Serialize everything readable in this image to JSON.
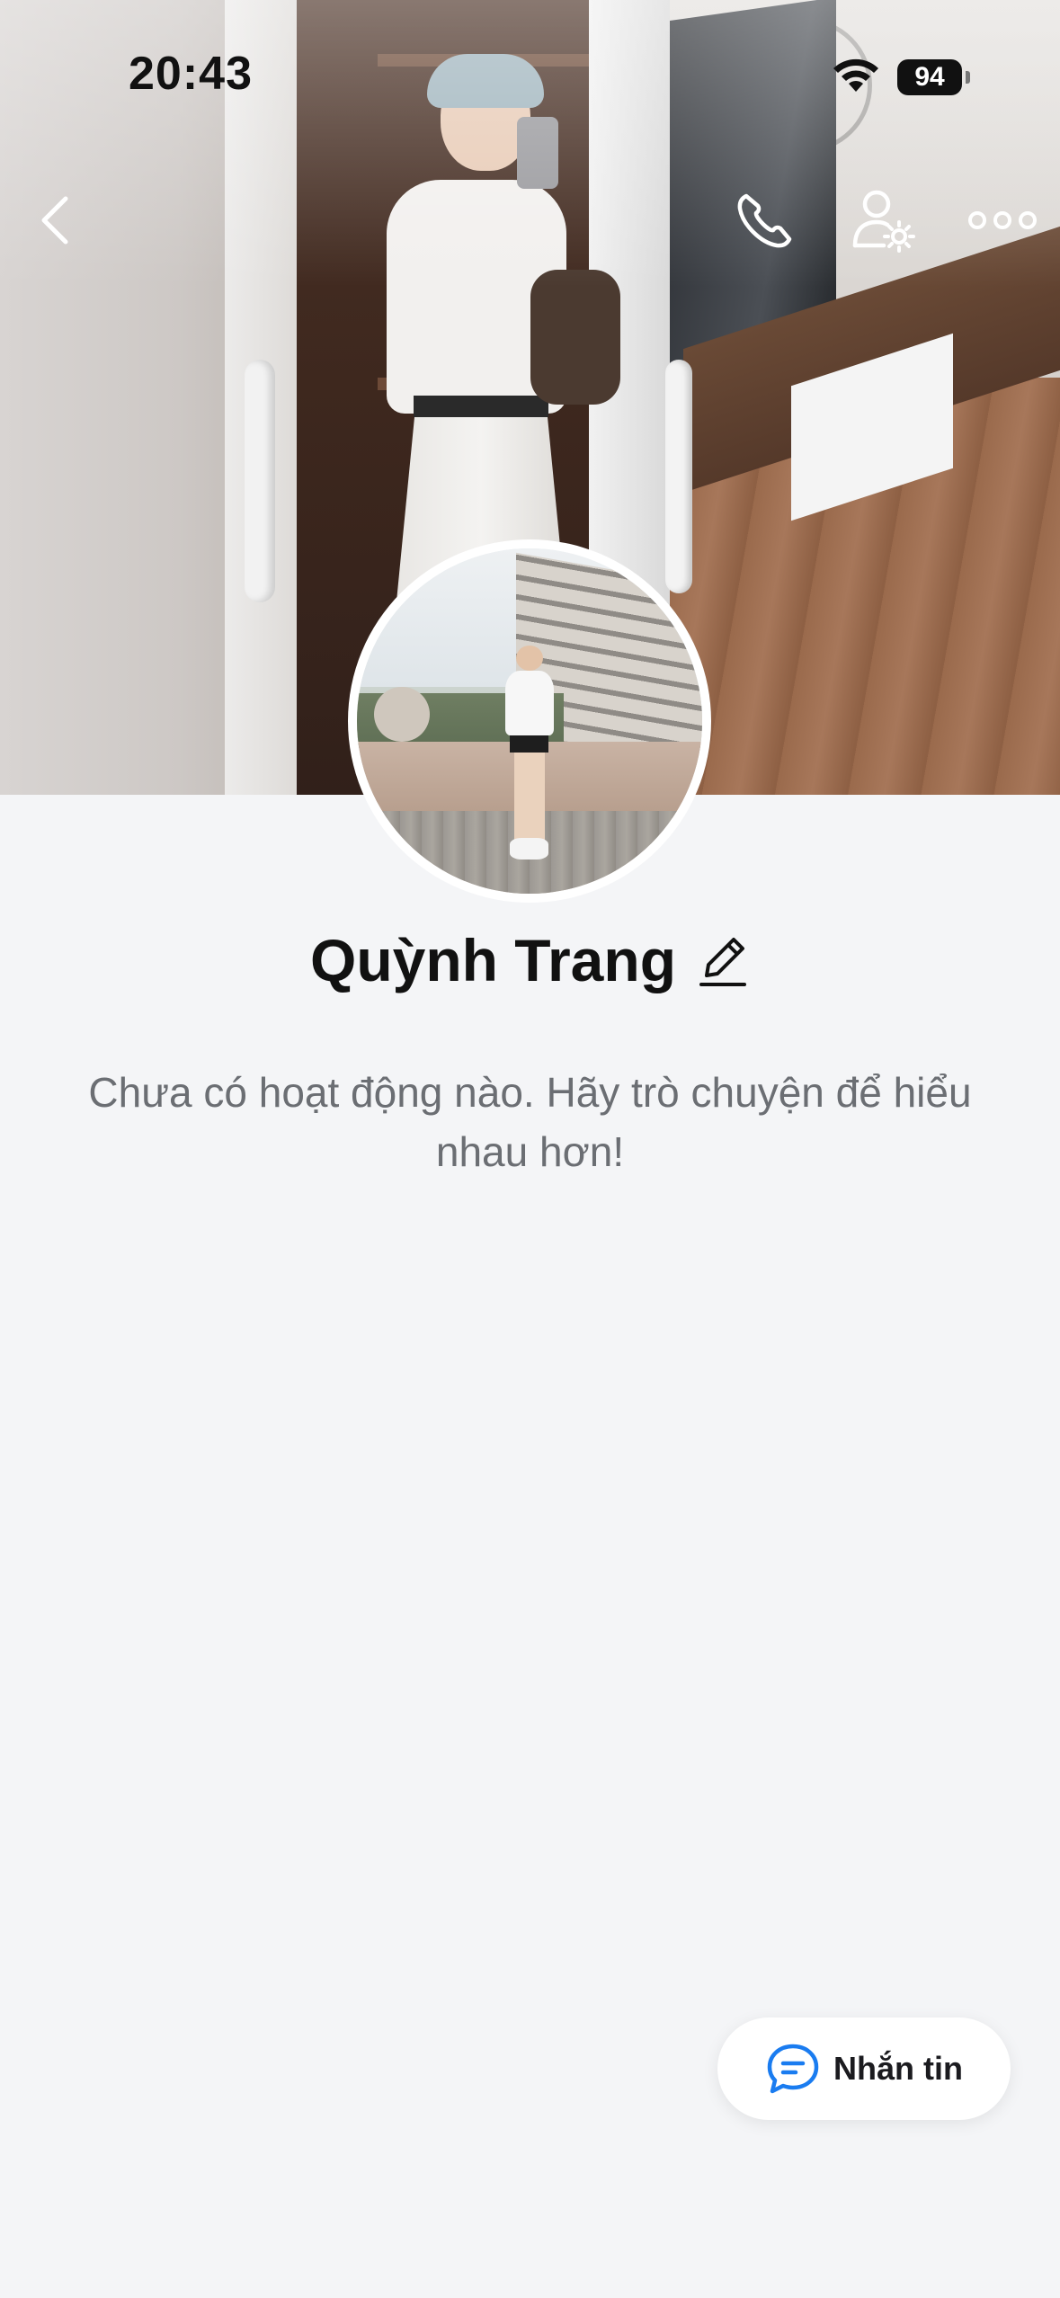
{
  "status_bar": {
    "time": "20:43",
    "battery": "94",
    "icons": [
      "wifi-icon",
      "battery-icon"
    ]
  },
  "nav": {
    "back_icon": "chevron-left-icon",
    "call_icon": "phone-icon",
    "settings_icon": "user-settings-icon",
    "more_icon": "more-horizontal-icon"
  },
  "profile": {
    "name": "Quỳnh Trang",
    "edit_icon": "pencil-icon",
    "empty_text": "Chưa có hoạt động nào. Hãy trò chuyện để hiểu nhau hơn!"
  },
  "message_button": {
    "label": "Nhắn tin",
    "icon": "chat-bubble-icon",
    "accent": "#1a7cf0"
  }
}
